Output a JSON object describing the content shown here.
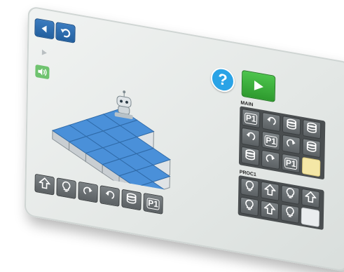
{
  "help": {
    "label": "?"
  },
  "main_panel": {
    "label": "MAIN",
    "cells": [
      {
        "icon": "p1"
      },
      {
        "icon": "turn-left-icon"
      },
      {
        "icon": "light-icon"
      },
      {
        "icon": "light-icon"
      },
      {
        "icon": "turn-left-icon"
      },
      {
        "icon": "p1"
      },
      {
        "icon": "turn-right-icon"
      },
      {
        "icon": "light-icon"
      },
      {
        "icon": "light-icon"
      },
      {
        "icon": "turn-right-icon"
      },
      {
        "icon": "p1"
      },
      {
        "icon": "empty"
      }
    ],
    "p1_label": "P1"
  },
  "proc1_panel": {
    "label": "PROC1",
    "cells": [
      {
        "icon": "bulb-icon"
      },
      {
        "icon": "forward-icon"
      },
      {
        "icon": "bulb-icon"
      },
      {
        "icon": "forward-icon"
      },
      {
        "icon": "bulb-icon"
      },
      {
        "icon": "forward-icon"
      },
      {
        "icon": "bulb-icon"
      },
      {
        "icon": "empty"
      }
    ]
  },
  "toolbar": {
    "items": [
      "forward-icon",
      "bulb-icon",
      "turn-right-icon",
      "turn-left-icon",
      "light-icon",
      "p1"
    ],
    "p1_label": "P1"
  },
  "colors": {
    "blue_button": "#2f6fb0",
    "play_green": "#3cb43c",
    "help_blue": "#2aa3e6",
    "tile_blue": "#4a90d9",
    "panel_dark": "#4a4e50",
    "empty_slot": "#f4e7a6"
  }
}
